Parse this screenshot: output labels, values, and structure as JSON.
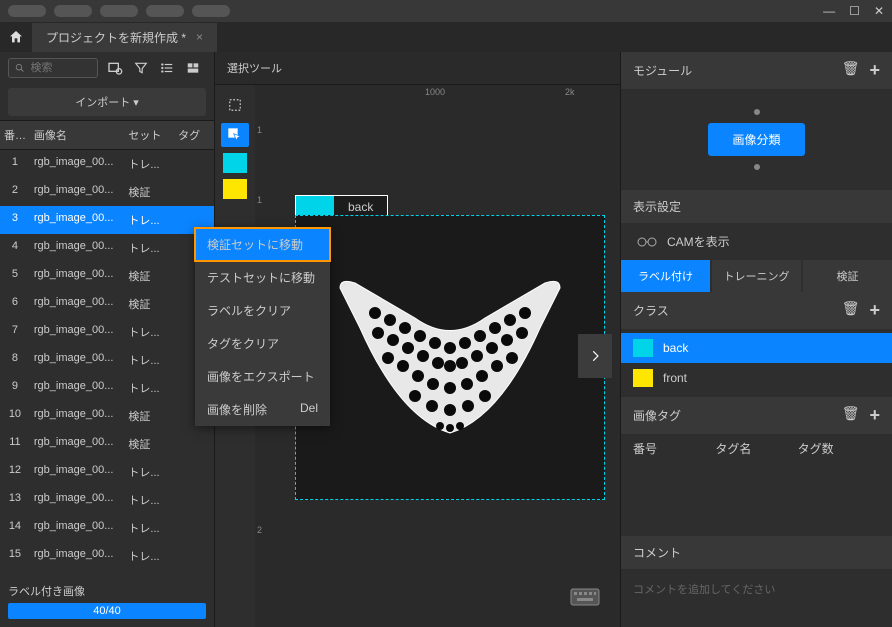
{
  "window": {
    "minimize": "—",
    "maximize": "☐",
    "close": "✕"
  },
  "tab": {
    "title": "プロジェクトを新規作成 *",
    "close": "×"
  },
  "search": {
    "placeholder": "検索"
  },
  "import_btn": "インポート ▾",
  "columns": {
    "num": "番号",
    "name": "画像名",
    "set": "セット",
    "tag": "タグ"
  },
  "images": [
    {
      "num": 1,
      "name": "rgb_image_00...",
      "set": "トレ...",
      "tag": "",
      "selected": false
    },
    {
      "num": 2,
      "name": "rgb_image_00...",
      "set": "検証",
      "tag": "",
      "selected": false
    },
    {
      "num": 3,
      "name": "rgb_image_00...",
      "set": "トレ...",
      "tag": "",
      "selected": true
    },
    {
      "num": 4,
      "name": "rgb_image_00...",
      "set": "トレ...",
      "tag": "",
      "selected": false
    },
    {
      "num": 5,
      "name": "rgb_image_00...",
      "set": "検証",
      "tag": "",
      "selected": false
    },
    {
      "num": 6,
      "name": "rgb_image_00...",
      "set": "検証",
      "tag": "",
      "selected": false
    },
    {
      "num": 7,
      "name": "rgb_image_00...",
      "set": "トレ...",
      "tag": "",
      "selected": false
    },
    {
      "num": 8,
      "name": "rgb_image_00...",
      "set": "トレ...",
      "tag": "",
      "selected": false
    },
    {
      "num": 9,
      "name": "rgb_image_00...",
      "set": "トレ...",
      "tag": "",
      "selected": false
    },
    {
      "num": 10,
      "name": "rgb_image_00...",
      "set": "検証",
      "tag": "",
      "selected": false
    },
    {
      "num": 11,
      "name": "rgb_image_00...",
      "set": "検証",
      "tag": "",
      "selected": false
    },
    {
      "num": 12,
      "name": "rgb_image_00...",
      "set": "トレ...",
      "tag": "",
      "selected": false
    },
    {
      "num": 13,
      "name": "rgb_image_00...",
      "set": "トレ...",
      "tag": "",
      "selected": false
    },
    {
      "num": 14,
      "name": "rgb_image_00...",
      "set": "トレ...",
      "tag": "",
      "selected": false
    },
    {
      "num": 15,
      "name": "rgb_image_00...",
      "set": "トレ...",
      "tag": "",
      "selected": false
    }
  ],
  "progress": {
    "label": "ラベル付き画像",
    "text": "40/40"
  },
  "canvas": {
    "header": "選択ツール",
    "label_text": "back",
    "ruler_marks": [
      "1000",
      "2k"
    ],
    "v_marks": [
      "1",
      "1",
      "2",
      "2"
    ]
  },
  "context_menu": [
    {
      "label": "検証セットに移動",
      "shortcut": "",
      "highlighted": true,
      "disabled": false
    },
    {
      "label": "テストセットに移動",
      "shortcut": "",
      "highlighted": false,
      "disabled": false
    },
    {
      "label": "ラベルをクリア",
      "shortcut": "",
      "highlighted": false,
      "disabled": false
    },
    {
      "label": "タグをクリア",
      "shortcut": "",
      "highlighted": false,
      "disabled": true
    },
    {
      "label": "画像をエクスポート",
      "shortcut": "",
      "highlighted": false,
      "disabled": false
    },
    {
      "label": "画像を削除",
      "shortcut": "Del",
      "highlighted": false,
      "disabled": false
    }
  ],
  "right": {
    "module_header": "モジュール",
    "module_chip": "画像分類",
    "display_header": "表示設定",
    "cam_label": "CAMを表示",
    "tabs": {
      "label": "ラベル付け",
      "train": "トレーニング",
      "val": "検証"
    },
    "class_header": "クラス",
    "classes": [
      {
        "name": "back",
        "color": "#00d4e8",
        "selected": true
      },
      {
        "name": "front",
        "color": "#ffe600",
        "selected": false
      }
    ],
    "tag_header": "画像タグ",
    "tag_cols": {
      "num": "番号",
      "name": "タグ名",
      "count": "タグ数"
    },
    "comment_header": "コメント",
    "comment_placeholder": "コメントを追加してください"
  },
  "colors": {
    "accent": "#0a84ff",
    "cyan": "#00d4e8",
    "yellow": "#ffe600",
    "highlight": "#ff9500"
  }
}
